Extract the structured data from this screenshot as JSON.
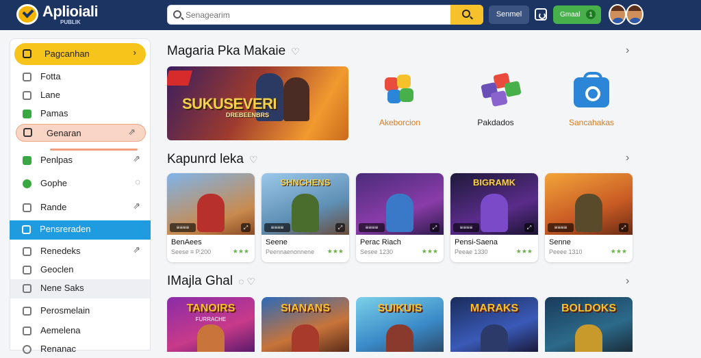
{
  "header": {
    "logo_text": "Aplioiali",
    "logo_sub": "PUBLIK",
    "search_placeholder": "Senagearim",
    "top_button": "Senmel",
    "download_button": "Gmaal",
    "download_count": "1"
  },
  "sidebar": {
    "items": [
      {
        "label": "Pagcanhan",
        "arrow": "›"
      },
      {
        "label": "Fotta",
        "arrow": ""
      },
      {
        "label": "Lane",
        "arrow": ""
      },
      {
        "label": "Pamas",
        "arrow": ""
      },
      {
        "label": "Genaran",
        "arrow": "⇗"
      },
      {
        "label": "Penlpas",
        "arrow": "⇗"
      },
      {
        "label": "Gophe",
        "arrow": "◌"
      },
      {
        "label": "Rande",
        "arrow": "⇗"
      },
      {
        "label": "Pensreraden",
        "arrow": ""
      },
      {
        "label": "Renedeks",
        "arrow": "⇗"
      },
      {
        "label": "Geoclen",
        "arrow": ""
      },
      {
        "label": "Nene Saks",
        "arrow": ""
      },
      {
        "label": "Perosmelain",
        "arrow": ""
      },
      {
        "label": "Aemelena",
        "arrow": ""
      },
      {
        "label": "Renanac",
        "arrow": ""
      }
    ]
  },
  "sections": [
    {
      "title": "Magaria Pka Makaie",
      "arrow": "›"
    },
    {
      "title": "Kapunrd leka",
      "arrow": "›"
    },
    {
      "title": "IMajla Ghal",
      "arrow": "›"
    }
  ],
  "featured": {
    "banner_title": "SUKUSEVERI",
    "banner_sub": "DREBEENBRS",
    "apps": [
      {
        "label": "Akeborcion"
      },
      {
        "label": "Pakdados"
      },
      {
        "label": "Sancahakas"
      }
    ]
  },
  "cards": [
    {
      "art_title": "",
      "badge": "≡≡≡≡",
      "name": "BenAees",
      "meta": "Seese ≡ P.200",
      "stars": "★★★"
    },
    {
      "art_title": "SHNCHENS",
      "badge": "≡≡≡≡",
      "name": "Seene",
      "meta": "Peennaenonnene",
      "stars": "★★★"
    },
    {
      "art_title": "",
      "badge": "≡≡≡≡",
      "name": "Perac Riach",
      "meta": "Sesee 1230",
      "stars": "★★★"
    },
    {
      "art_title": "BIGRAMK",
      "badge": "≡≡≡≡",
      "name": "Pensi-Saena",
      "meta": "Peeae 1330",
      "stars": "★★★"
    },
    {
      "art_title": "",
      "badge": "≡≡≡≡",
      "name": "Senne",
      "meta": "Peeee 1310",
      "stars": "★★★"
    }
  ],
  "row2": [
    {
      "title": "TANOIRS",
      "sub": "FURRACHE"
    },
    {
      "title": "SIANANS",
      "sub": ""
    },
    {
      "title": "SUIKUIS",
      "sub": ""
    },
    {
      "title": "MARAKS",
      "sub": ""
    },
    {
      "title": "BOLDOKS",
      "sub": ""
    }
  ],
  "colors": {
    "topbar": "#1c3461",
    "accent_yellow": "#f6c41b",
    "sidebar_active": "#1f9be0",
    "download_green": "#47b04b"
  }
}
